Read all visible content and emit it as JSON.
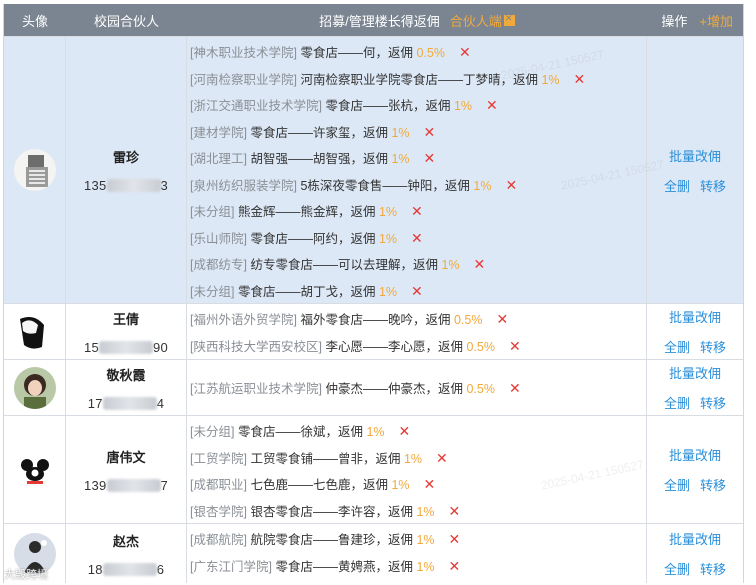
{
  "header": {
    "avatar": "头像",
    "partner": "校园合伙人",
    "records": "招募/管理楼长得返佣",
    "partner_port": "合伙人端",
    "actions": "操作",
    "add": "+增加"
  },
  "rows": [
    {
      "name": "雷珍",
      "phone_prefix": "135",
      "phone_suffix": "3",
      "records": [
        {
          "school": "[神木职业技术学院]",
          "store": "零食店——何，返佣",
          "rate": "0.5%"
        },
        {
          "school": "[河南检察职业学院]",
          "store": "河南检察职业学院零食店——丁梦晴，返佣",
          "rate": "1%"
        },
        {
          "school": "[浙江交通职业技术学院]",
          "store": "零食店——张杭，返佣",
          "rate": "1%"
        },
        {
          "school": "[建材学院]",
          "store": "零食店——许家玺，返佣",
          "rate": "1%"
        },
        {
          "school": "[湖北理工]",
          "store": "胡智强——胡智强，返佣",
          "rate": "1%"
        },
        {
          "school": "[泉州纺织服装学院]",
          "store": "5栋深夜零食售——钟阳，返佣",
          "rate": "1%"
        },
        {
          "school": "[未分组]",
          "store": "熊金辉——熊金辉，返佣",
          "rate": "1%"
        },
        {
          "school": "[乐山师院]",
          "store": "零食店——阿约，返佣",
          "rate": "1%"
        },
        {
          "school": "[成都纺专]",
          "store": "纺专零食店——可以去理解，返佣",
          "rate": "1%"
        },
        {
          "school": "[未分组]",
          "store": "零食店——胡丁戈，返佣",
          "rate": "1%"
        }
      ]
    },
    {
      "name": "王倩",
      "phone_prefix": "15",
      "phone_suffix": "90",
      "records": [
        {
          "school": "[福州外语外贸学院]",
          "store": "福外零食店——晚吟，返佣",
          "rate": "0.5%"
        },
        {
          "school": "[陕西科技大学西安校区]",
          "store": "李心愿——李心愿，返佣",
          "rate": "0.5%"
        }
      ]
    },
    {
      "name": "敬秋霞",
      "phone_prefix": "17",
      "phone_suffix": "4",
      "records": [
        {
          "school": "[江苏航运职业技术学院]",
          "store": "仲豪杰——仲豪杰，返佣",
          "rate": "0.5%"
        }
      ]
    },
    {
      "name": "唐伟文",
      "phone_prefix": "139",
      "phone_suffix": "7",
      "records": [
        {
          "school": "[未分组]",
          "store": "零食店——徐斌，返佣",
          "rate": "1%"
        },
        {
          "school": "[工贸学院]",
          "store": "工贸零食铺——曾非，返佣",
          "rate": "1%"
        },
        {
          "school": "[成都职业]",
          "store": "七色鹿——七色鹿，返佣",
          "rate": "1%"
        },
        {
          "school": "[银杏学院]",
          "store": "银杏零食店——李许容，返佣",
          "rate": "1%"
        }
      ]
    },
    {
      "name": "赵杰",
      "phone_prefix": "18",
      "phone_suffix": "6",
      "records": [
        {
          "school": "[成都航院]",
          "store": "航院零食店——鲁建珍，返佣",
          "rate": "1%"
        },
        {
          "school": "[广东江门学院]",
          "store": "零食店——黄娉燕，返佣",
          "rate": "1%"
        }
      ]
    }
  ],
  "actions": {
    "batch_edit": "批量改佣",
    "delete_all": "全删",
    "transfer": "转移"
  },
  "delete_icon": "✕",
  "watermark": "2025-04-21 150527",
  "logo_text": "大毁跨境"
}
